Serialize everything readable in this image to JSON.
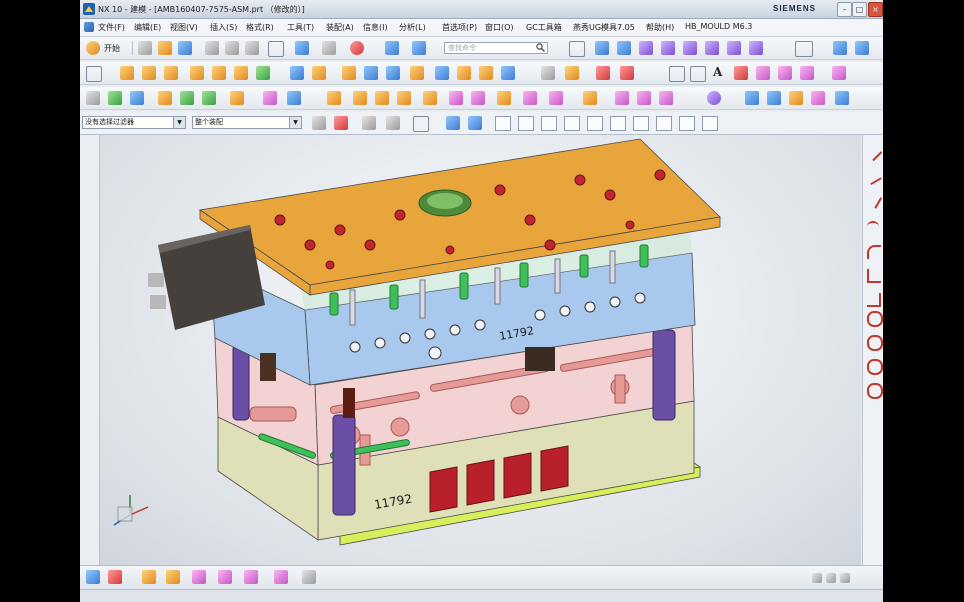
{
  "window": {
    "title": "NX 10 - 建模 - [AMB160407-7575-ASM.prt （修改的）]",
    "brand": "SIEMENS",
    "minimize": "–",
    "restore": "□",
    "close": "×"
  },
  "menubar": {
    "items": [
      "文件(F)",
      "编辑(E)",
      "视图(V)",
      "插入(S)",
      "格式(R)",
      "工具(T)",
      "装配(A)",
      "信息(I)",
      "分析(L)",
      "首选项(P)",
      "窗口(O)",
      "GC工具箱",
      "燕秀UG模具7.05",
      "帮助(H)",
      "HB_MOULD M6.3"
    ]
  },
  "toolbar1": {
    "start_label": "开始",
    "search_placeholder": "查找命令"
  },
  "toolbar2": {
    "text_tool": "A"
  },
  "filterbar": {
    "selection_filter": "没有选择过滤器",
    "assembly_scope": "整个装配"
  },
  "model": {
    "part_number_top": "11792",
    "part_number_bottom": "11792",
    "colors": {
      "top_plate": "#e8a53c",
      "cavity_plate": "#a9c8ee",
      "core_plate": "#f2d2d2",
      "support_plate": "#dfe0b8",
      "base_plate": "#d7ef5a",
      "pillar": "#6b4fa6",
      "water_pipe": "#3fbf5a",
      "cooling_part": "#e69a98",
      "red_insert": "#b8202a"
    }
  }
}
